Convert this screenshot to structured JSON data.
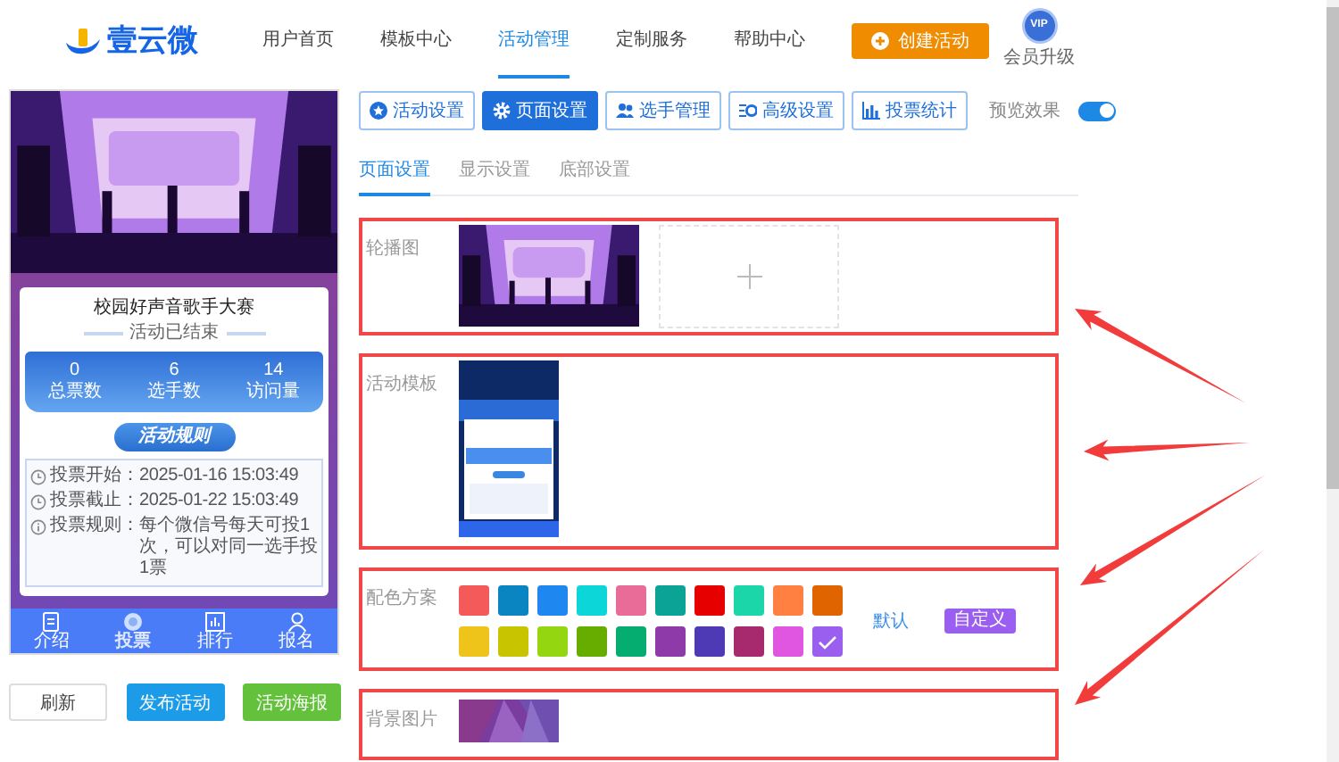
{
  "header": {
    "logo_text": "壹云微",
    "nav": [
      {
        "label": "用户首页",
        "selected": false
      },
      {
        "label": "模板中心",
        "selected": false
      },
      {
        "label": "活动管理",
        "selected": true
      },
      {
        "label": "定制服务",
        "selected": false
      },
      {
        "label": "帮助中心",
        "selected": false
      }
    ],
    "create_button": "创建活动",
    "vip_badge": "VIP",
    "vip_label": "会员升级"
  },
  "preview": {
    "title": "校园好声音歌手大赛",
    "status": "活动已结束",
    "stats": [
      {
        "value": "0",
        "label": "总票数"
      },
      {
        "value": "6",
        "label": "选手数"
      },
      {
        "value": "14",
        "label": "访问量"
      }
    ],
    "rules_button": "活动规则",
    "info": [
      {
        "kind": "clock",
        "label": "投票开始：",
        "value": "2025-01-16 15:03:49"
      },
      {
        "kind": "clock",
        "label": "投票截止：",
        "value": "2025-01-22 15:03:49"
      },
      {
        "kind": "info",
        "label": "投票规则：",
        "value": "每个微信号每天可投1次，可以对同一选手投1票"
      }
    ],
    "tabbar": [
      {
        "kind": "document",
        "label": "介绍",
        "selected": false
      },
      {
        "kind": "vote",
        "label": "投票",
        "selected": true
      },
      {
        "kind": "chart",
        "label": "排行",
        "selected": false
      },
      {
        "kind": "person",
        "label": "报名",
        "selected": false
      }
    ],
    "buttons": [
      {
        "kind": "plain",
        "label": "刷新"
      },
      {
        "kind": "primary",
        "label": "发布活动"
      },
      {
        "kind": "success",
        "label": "活动海报"
      }
    ]
  },
  "toolbar": {
    "buttons": [
      {
        "kind": "star",
        "label": "活动设置",
        "selected": false
      },
      {
        "kind": "gear",
        "label": "页面设置",
        "selected": true
      },
      {
        "kind": "people",
        "label": "选手管理",
        "selected": false
      },
      {
        "kind": "config",
        "label": "高级设置",
        "selected": false
      },
      {
        "kind": "chart",
        "label": "投票统计",
        "selected": false
      }
    ],
    "preview_toggle": {
      "label": "预览效果",
      "on": true
    }
  },
  "subtabs": [
    {
      "label": "页面设置",
      "selected": true
    },
    {
      "label": "显示设置",
      "selected": false
    },
    {
      "label": "底部设置",
      "selected": false
    }
  ],
  "sections": [
    {
      "kind": "carousel",
      "label": "轮播图",
      "highlighted": true
    },
    {
      "kind": "template",
      "label": "活动模板",
      "highlighted": true
    },
    {
      "kind": "colors",
      "label": "配色方案",
      "highlighted": true,
      "default_link": "默认",
      "custom_button": "自定义",
      "swatches": [
        {
          "color": "#f55a5a",
          "selected": false
        },
        {
          "color": "#0a85c2",
          "selected": false
        },
        {
          "color": "#1e88f0",
          "selected": false
        },
        {
          "color": "#0dd6d9",
          "selected": false
        },
        {
          "color": "#e96b97",
          "selected": false
        },
        {
          "color": "#0aa396",
          "selected": false
        },
        {
          "color": "#e60000",
          "selected": false
        },
        {
          "color": "#1ad6a8",
          "selected": false
        },
        {
          "color": "#ff8040",
          "selected": false
        },
        {
          "color": "#e06400",
          "selected": false
        },
        {
          "color": "#eec41a",
          "selected": false
        },
        {
          "color": "#c9c400",
          "selected": false
        },
        {
          "color": "#94d610",
          "selected": false
        },
        {
          "color": "#66ad00",
          "selected": false
        },
        {
          "color": "#05ad70",
          "selected": false
        },
        {
          "color": "#8e3aa8",
          "selected": false
        },
        {
          "color": "#4e3ab5",
          "selected": false
        },
        {
          "color": "#a82a6e",
          "selected": false
        },
        {
          "color": "#e056e0",
          "selected": false
        },
        {
          "color": "#9b5ff0",
          "selected": true
        }
      ]
    },
    {
      "kind": "background",
      "label": "背景图片",
      "highlighted": true
    }
  ]
}
